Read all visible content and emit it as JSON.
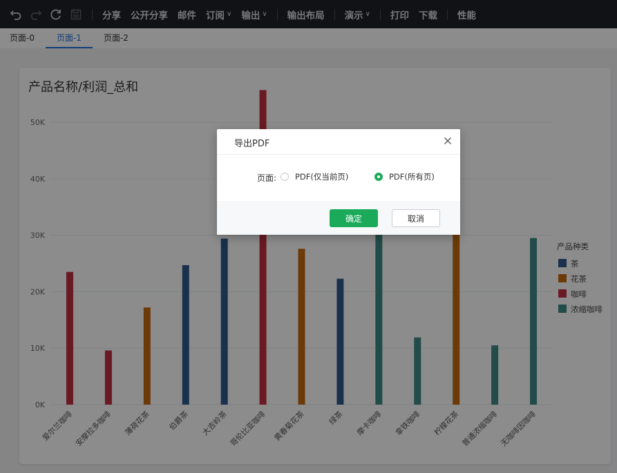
{
  "toolbar": {
    "undo_icon": "undo-icon",
    "redo_icon": "redo-icon",
    "refresh_icon": "refresh-icon",
    "save_icon": "save-icon",
    "share": "分享",
    "public_share": "公开分享",
    "mail": "邮件",
    "subscribe": "订阅",
    "export": "输出",
    "export_layout": "输出布局",
    "present": "演示",
    "print": "打印",
    "download": "下载",
    "performance": "性能"
  },
  "tabs": [
    "页面-0",
    "页面-1",
    "页面-2"
  ],
  "active_tab": 1,
  "card": {
    "title": "产品名称/利润_总和"
  },
  "chart_data": {
    "type": "bar",
    "title": "产品名称/利润_总和",
    "categories": [
      "爱尔兰咖啡",
      "安摩拉多咖啡",
      "薄荷花茶",
      "伯爵茶",
      "大吉岭茶",
      "哥伦比亚咖啡",
      "黄春菊花茶",
      "绿茶",
      "摩卡咖啡",
      "拿铁咖啡",
      "柠檬花茶",
      "普通浓缩咖啡",
      "无咖啡因咖啡"
    ],
    "values": [
      23500,
      9600,
      17200,
      24700,
      29400,
      55700,
      27600,
      22300,
      31700,
      11900,
      31800,
      10500,
      29500
    ],
    "groups": [
      "咖啡",
      "咖啡",
      "花茶",
      "茶",
      "茶",
      "咖啡",
      "花茶",
      "茶",
      "浓缩咖啡",
      "浓缩咖啡",
      "花茶",
      "浓缩咖啡",
      "浓缩咖啡"
    ],
    "ylim": [
      0,
      56000
    ],
    "yticks": [
      0,
      10000,
      20000,
      30000,
      40000,
      50000
    ],
    "ytick_labels": [
      "0K",
      "10K",
      "20K",
      "30K",
      "40K",
      "50K"
    ],
    "legend": {
      "title": "产品种类",
      "placement": "right",
      "items": [
        {
          "name": "茶",
          "color": "#2e5a8c"
        },
        {
          "name": "花茶",
          "color": "#c56a12"
        },
        {
          "name": "咖啡",
          "color": "#c0303e"
        },
        {
          "name": "浓缩咖啡",
          "color": "#3f8a86"
        }
      ]
    },
    "grid": true
  },
  "dialog": {
    "title": "导出PDF",
    "close_icon": "close-icon",
    "page_label": "页面:",
    "option_current": "PDF(仅当前页)",
    "option_all": "PDF(所有页)",
    "selected": "all",
    "ok": "确定",
    "cancel": "取消"
  }
}
